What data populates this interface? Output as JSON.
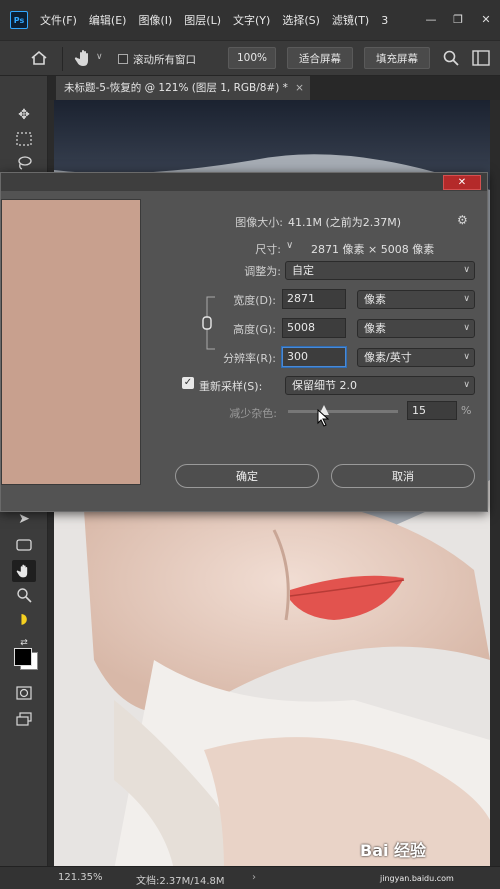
{
  "app": {
    "logo": "Ps",
    "menu": [
      "文件(F)",
      "编辑(E)",
      "图像(I)",
      "图层(L)",
      "文字(Y)",
      "选择(S)",
      "滤镜(T)",
      "3"
    ]
  },
  "options_bar": {
    "scroll_all_windows": "滚动所有窗口",
    "zoom_100": "100%",
    "fit_screen": "适合屏幕",
    "fill_screen": "填充屏幕"
  },
  "document_tab": {
    "title": "未标题-5-恢复的 @ 121% (图层 1, RGB/8#) *",
    "close": "×"
  },
  "dialog": {
    "close": "✕",
    "image_size_label": "图像大小:",
    "image_size_value": "41.1M (之前为2.37M)",
    "dimensions_label": "尺寸:",
    "dimensions_value": "2871 像素 × 5008 像素",
    "fit_to_label": "调整为:",
    "fit_to_value": "自定",
    "width_label": "宽度(D):",
    "width_value": "2871",
    "width_unit": "像素",
    "height_label": "高度(G):",
    "height_value": "5008",
    "height_unit": "像素",
    "resolution_label": "分辨率(R):",
    "resolution_value": "300",
    "resolution_unit": "像素/英寸",
    "resample_label": "重新采样(S):",
    "resample_checked": true,
    "resample_value": "保留细节 2.0",
    "noise_label": "减少杂色:",
    "noise_value": "15",
    "noise_unit": "%",
    "noise_slider_fraction": 0.15,
    "ok": "确定",
    "cancel": "取消"
  },
  "status_bar": {
    "zoom": "121.35%",
    "doc_info": "文档:2.37M/14.8M",
    "watermark": "Bai 经验",
    "watermark_url": "jingyan.baidu.com"
  },
  "colors": {
    "accent_blue": "#31a8ff",
    "close_red": "#b42a2a",
    "focus_blue": "#4a8ad6"
  }
}
